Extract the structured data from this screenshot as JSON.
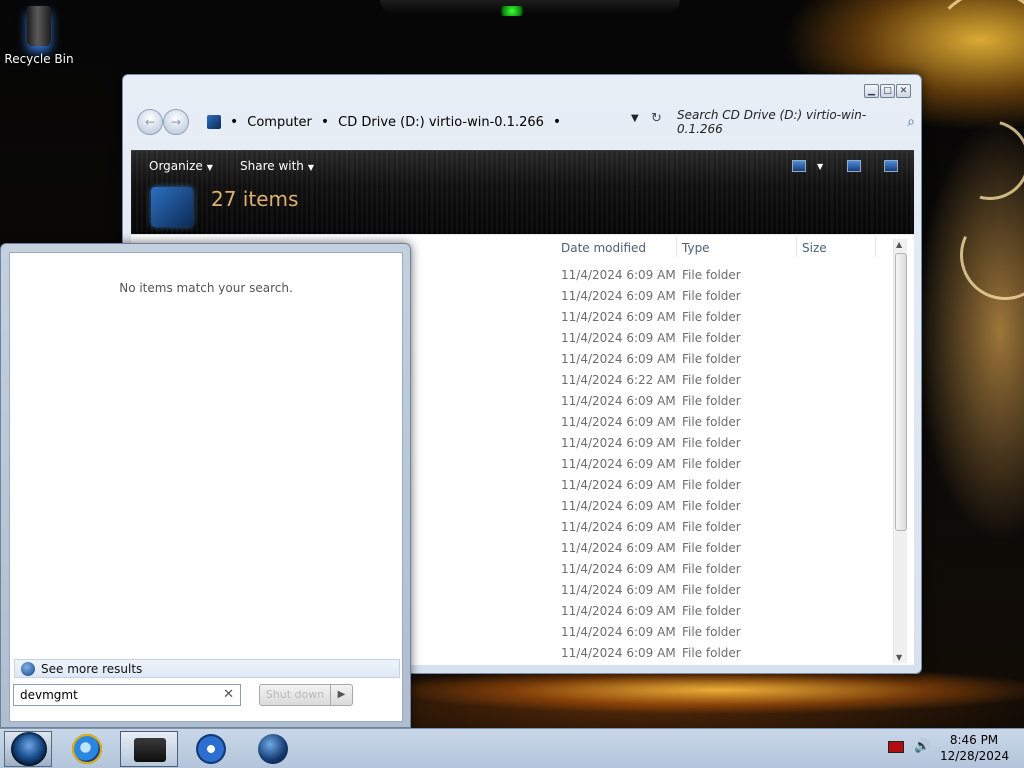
{
  "desktop": {
    "recycle_bin_label": "Recycle Bin"
  },
  "explorer": {
    "breadcrumb": [
      "Computer",
      "CD Drive (D:) virtio-win-0.1.266"
    ],
    "search_placeholder": "Search CD Drive (D:) virtio-win-0.1.266",
    "toolbar": {
      "organize_label": "Organize",
      "share_with_label": "Share with"
    },
    "items_count": "27 items",
    "columns": [
      "Date modified",
      "Type",
      "Size"
    ],
    "rows": [
      {
        "date": "11/4/2024 6:09 AM",
        "type": "File folder"
      },
      {
        "date": "11/4/2024 6:09 AM",
        "type": "File folder"
      },
      {
        "date": "11/4/2024 6:09 AM",
        "type": "File folder"
      },
      {
        "date": "11/4/2024 6:09 AM",
        "type": "File folder"
      },
      {
        "date": "11/4/2024 6:09 AM",
        "type": "File folder"
      },
      {
        "date": "11/4/2024 6:22 AM",
        "type": "File folder"
      },
      {
        "date": "11/4/2024 6:09 AM",
        "type": "File folder"
      },
      {
        "date": "11/4/2024 6:09 AM",
        "type": "File folder"
      },
      {
        "date": "11/4/2024 6:09 AM",
        "type": "File folder"
      },
      {
        "date": "11/4/2024 6:09 AM",
        "type": "File folder"
      },
      {
        "date": "11/4/2024 6:09 AM",
        "type": "File folder"
      },
      {
        "date": "11/4/2024 6:09 AM",
        "type": "File folder"
      },
      {
        "date": "11/4/2024 6:09 AM",
        "type": "File folder"
      },
      {
        "date": "11/4/2024 6:09 AM",
        "type": "File folder"
      },
      {
        "date": "11/4/2024 6:09 AM",
        "type": "File folder"
      },
      {
        "date": "11/4/2024 6:09 AM",
        "type": "File folder"
      },
      {
        "date": "11/4/2024 6:09 AM",
        "type": "File folder"
      },
      {
        "date": "11/4/2024 6:09 AM",
        "type": "File folder"
      },
      {
        "date": "11/4/2024 6:09 AM",
        "type": "File folder"
      }
    ]
  },
  "start_menu": {
    "no_items_text": "No items match your search.",
    "see_more_label": "See more results",
    "search_value": "devmgmt",
    "shutdown_label": "Shut down"
  },
  "taskbar": {
    "apps": [
      "internet-explorer",
      "windows-explorer",
      "media-player",
      "globe-app"
    ],
    "time": "8:46 PM",
    "date": "12/28/2024"
  }
}
